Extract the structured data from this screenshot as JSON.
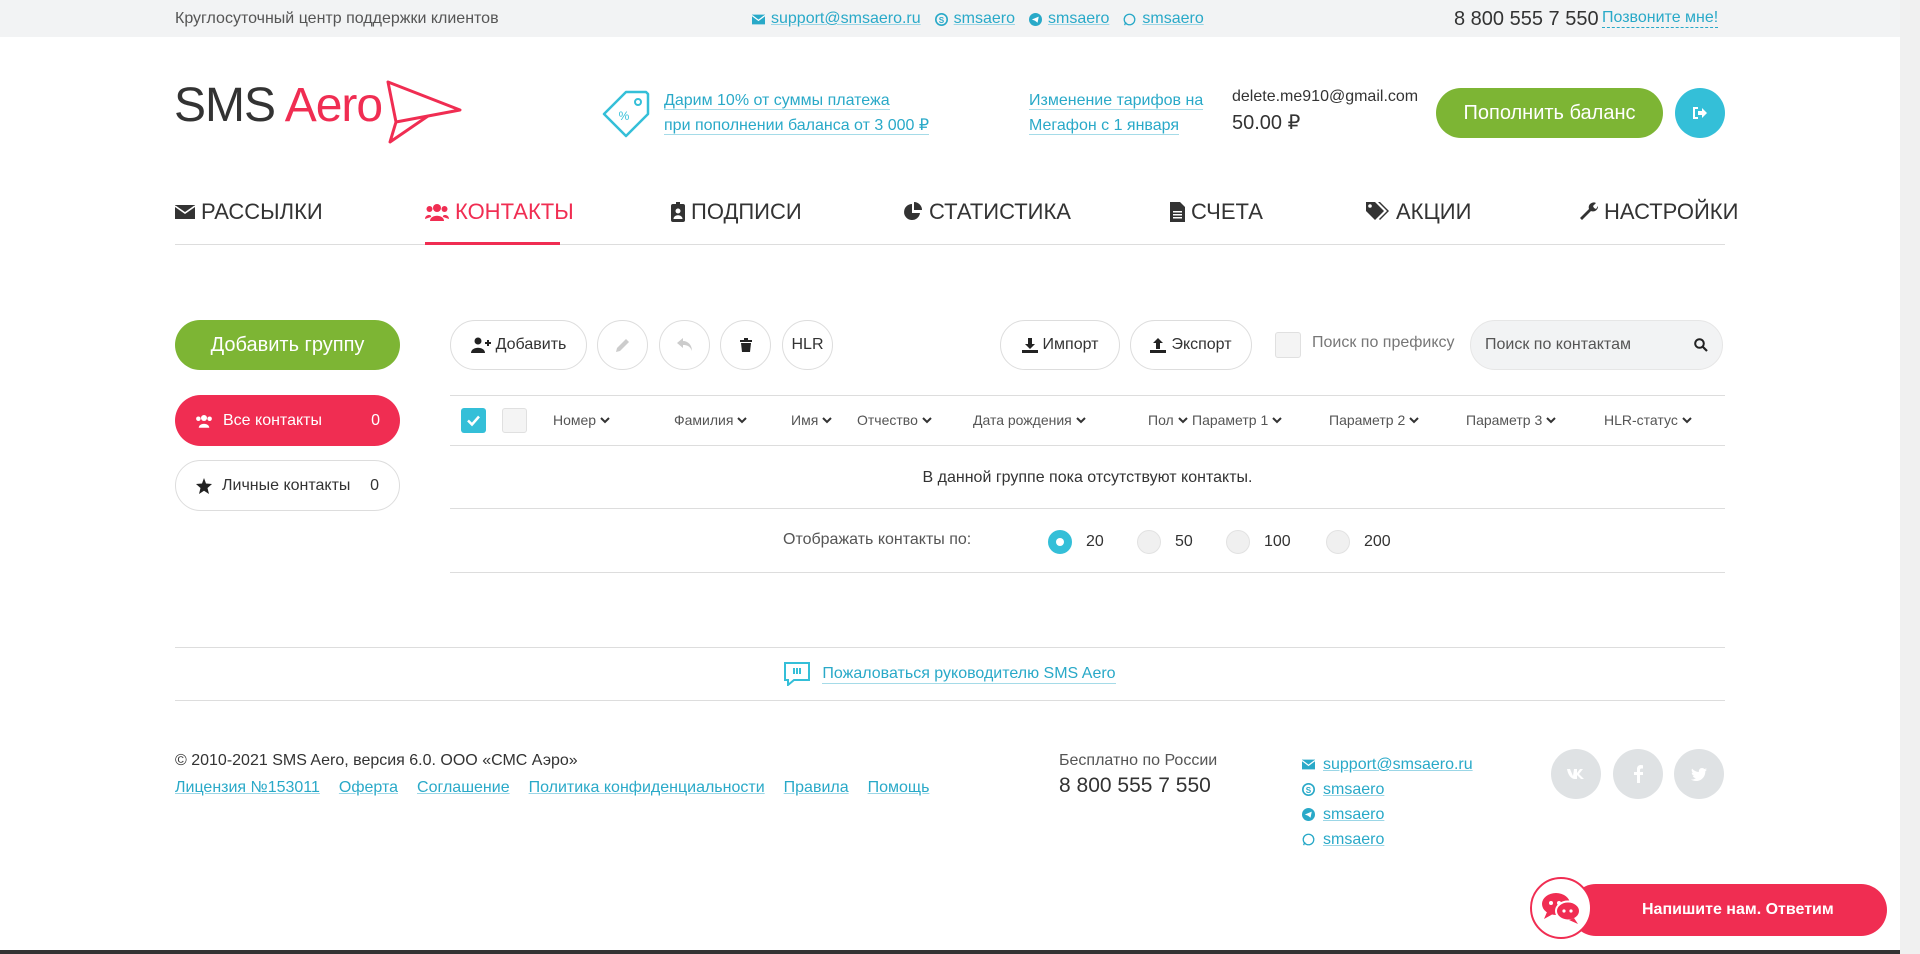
{
  "topbar": {
    "support_text": "Круглосуточный центр поддержки клиентов",
    "email": "support@smsaero.ru",
    "skype": "smsaero",
    "telegram": "smsaero",
    "whatsapp": "smsaero",
    "phone": "8 800 555 7 550",
    "callme": "Позвоните мне!"
  },
  "header": {
    "logo_sms": "SMS",
    "logo_aero": "Aero",
    "promo_line1": "Дарим 10% от суммы платежа",
    "promo_line2": "при пополнении баланса от 3 000 ₽",
    "tariff_line1": "Изменение тарифов на",
    "tariff_line2": "Мегафон с 1 января",
    "account_email": "delete.me910@gmail.com",
    "balance": "50.00 ₽",
    "topup_label": "Пополнить баланс"
  },
  "nav": {
    "items": [
      {
        "label": "РАССЫЛКИ"
      },
      {
        "label": "КОНТАКТЫ"
      },
      {
        "label": "ПОДПИСИ"
      },
      {
        "label": "СТАТИСТИКА"
      },
      {
        "label": "СЧЕТА"
      },
      {
        "label": "АКЦИИ"
      },
      {
        "label": "НАСТРОЙКИ"
      }
    ]
  },
  "sidebar": {
    "add_group_label": "Добавить группу",
    "groups": [
      {
        "label": "Все контакты",
        "count": "0"
      },
      {
        "label": "Личные контакты",
        "count": "0"
      }
    ]
  },
  "toolbar": {
    "add_label": "Добавить",
    "hlr_label": "HLR",
    "import_label": "Импорт",
    "export_label": "Экспорт",
    "prefix_label": "Поиск по префиксу",
    "search_placeholder": "Поиск по контактам"
  },
  "table": {
    "columns": [
      "Номер",
      "Фамилия",
      "Имя",
      "Отчество",
      "Дата рождения",
      "Пол",
      "Параметр 1",
      "Параметр 2",
      "Параметр 3",
      "HLR-статус"
    ],
    "empty_text": "В данной группе пока отсутствуют контакты.",
    "perpage_label": "Отображать контакты по:",
    "perpage_options": [
      "20",
      "50",
      "100",
      "200"
    ],
    "perpage_selected": "20"
  },
  "complaint": {
    "label": "Пожаловаться руководителю SMS Aero"
  },
  "footer": {
    "copyright": "© 2010-2021 SMS Aero, версия 6.0. ООО «СМС Аэро»",
    "links": [
      "Лицензия №153011",
      "Оферта",
      "Соглашение",
      "Политика конфиденциальности",
      "Правила",
      "Помощь"
    ],
    "free_label": "Бесплатно по России",
    "free_phone": "8 800 555 7 550",
    "email": "support@smsaero.ru",
    "skype": "smsaero",
    "telegram": "smsaero",
    "whatsapp": "smsaero"
  },
  "chat": {
    "label": "Напишите нам. Ответим сразу!"
  },
  "colors": {
    "accent": "#f02d52",
    "green": "#7db534",
    "link": "#29a9c8",
    "cyan": "#34bfd8"
  }
}
